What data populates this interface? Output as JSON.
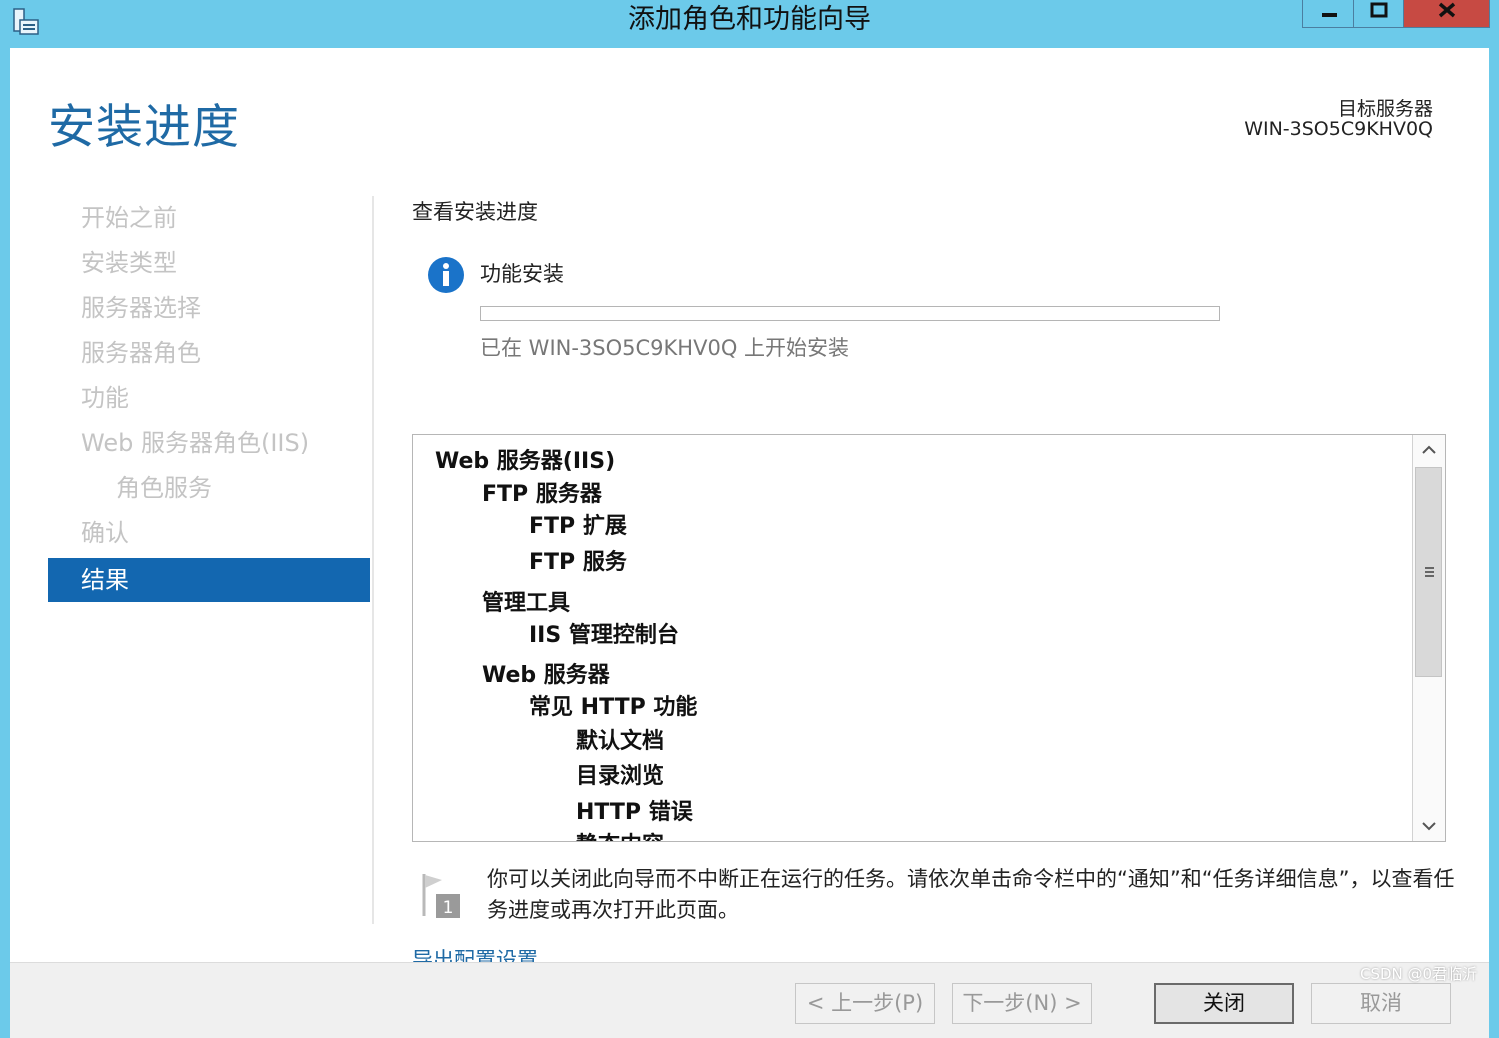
{
  "window": {
    "title": "添加角色和功能向导",
    "controls": {
      "minimize": "minimize-icon",
      "maximize": "maximize-icon",
      "close": "close-icon"
    }
  },
  "header": {
    "page_title": "安装进度",
    "target_label": "目标服务器",
    "target_value": "WIN-3SO5C9KHV0Q"
  },
  "nav": {
    "items": [
      {
        "label": "开始之前"
      },
      {
        "label": "安装类型"
      },
      {
        "label": "服务器选择"
      },
      {
        "label": "服务器角色"
      },
      {
        "label": "功能"
      },
      {
        "label": "Web 服务器角色(IIS)"
      },
      {
        "label": "角色服务"
      },
      {
        "label": "确认"
      },
      {
        "label": "结果"
      }
    ],
    "active_index": 8
  },
  "content": {
    "section_heading": "查看安装进度",
    "feature_label": "功能安装",
    "progress_fraction": 0,
    "status_text": "已在 WIN-3SO5C9KHV0Q 上开始安装",
    "tree": [
      {
        "label": "Web 服务器(IIS)",
        "level": 0
      },
      {
        "label": "FTP 服务器",
        "level": 1
      },
      {
        "label": "FTP 扩展",
        "level": 2
      },
      {
        "label": "FTP 服务",
        "level": 2
      },
      {
        "label": "管理工具",
        "level": 1
      },
      {
        "label": "IIS 管理控制台",
        "level": 2
      },
      {
        "label": "Web 服务器",
        "level": 1
      },
      {
        "label": "常见 HTTP 功能",
        "level": 2
      },
      {
        "label": "默认文档",
        "level": 3
      },
      {
        "label": "目录浏览",
        "level": 3
      },
      {
        "label": "HTTP 错误",
        "level": 3
      },
      {
        "label": "静态内容",
        "level": 3
      }
    ],
    "note_text": "你可以关闭此向导而不中断正在运行的任务。请依次单击命令栏中的“通知”和“任务详细信息”，以查看任务进度或再次打开此页面。",
    "export_link": "导出配置设置"
  },
  "footer": {
    "prev": "< 上一步(P)",
    "next": "下一步(N) >",
    "close": "关闭",
    "cancel": "取消"
  },
  "watermark": "CSDN @0君临沂",
  "colors": {
    "title_bar": "#6ccaea",
    "accent": "#1f6aa5",
    "nav_active": "#1367b0",
    "close_button": "#c74a43"
  }
}
